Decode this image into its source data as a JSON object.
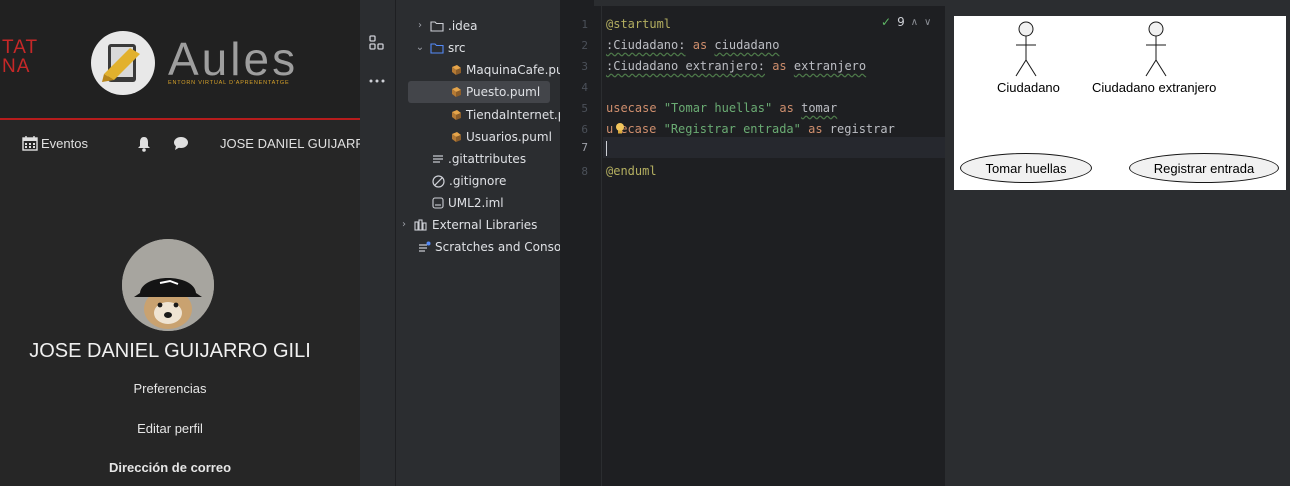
{
  "aules": {
    "university_fragment_1": "TAT",
    "university_fragment_2": "NA",
    "brand_name": "Aules",
    "brand_subtitle": "ENTORN VIRTUAL D'APRENENTATGE",
    "nav": {
      "events_label": "Eventos",
      "user_name_short": "JOSE DANIEL GUIJARRO"
    },
    "profile": {
      "full_name": "JOSE DANIEL GUIJARRO GILI",
      "links": [
        "Preferencias",
        "Editar perfil",
        "Dirección de correo"
      ]
    },
    "colors": {
      "accent": "#b71c1c",
      "brand_gold": "#d4a02a"
    }
  },
  "project_tree": {
    "items": [
      {
        "label": ".idea",
        "type": "folder",
        "expanded": false
      },
      {
        "label": "src",
        "type": "folder",
        "expanded": true
      },
      {
        "label": "MaquinaCafe.pu",
        "type": "puml"
      },
      {
        "label": "Puesto.puml",
        "type": "puml",
        "selected": true
      },
      {
        "label": "TiendaInternet.p",
        "type": "puml"
      },
      {
        "label": "Usuarios.puml",
        "type": "puml"
      },
      {
        "label": ".gitattributes",
        "type": "gitattributes"
      },
      {
        "label": ".gitignore",
        "type": "gitignore"
      },
      {
        "label": "UML2.iml",
        "type": "iml"
      },
      {
        "label": "External Libraries",
        "type": "libraries",
        "expanded": false
      },
      {
        "label": "Scratches and Consol",
        "type": "scratches"
      }
    ]
  },
  "editor": {
    "line_numbers": [
      "1",
      "2",
      "3",
      "4",
      "5",
      "6",
      "7",
      "8"
    ],
    "current_line": "7",
    "inspection_count": "9",
    "lines": {
      "l1": "@startuml",
      "l2_a": ":Ciudadano:",
      "l2_b": "as",
      "l2_c": "ciudadano",
      "l3_a": ":Ciudadano extranjero:",
      "l3_b": "as",
      "l3_c": "extranjero",
      "l5_a": "usecase",
      "l5_b": "\"Tomar huellas\"",
      "l5_c": "as",
      "l5_d": "tomar",
      "l6_a": "u",
      "l6_a2": "ecase",
      "l6_b": "\"Registrar entrada\"",
      "l6_c": "as",
      "l6_d": "registrar",
      "l8": "@enduml"
    }
  },
  "preview": {
    "actors": [
      "Ciudadano",
      "Ciudadano extranjero"
    ],
    "usecases": [
      "Tomar huellas",
      "Registrar entrada"
    ]
  }
}
